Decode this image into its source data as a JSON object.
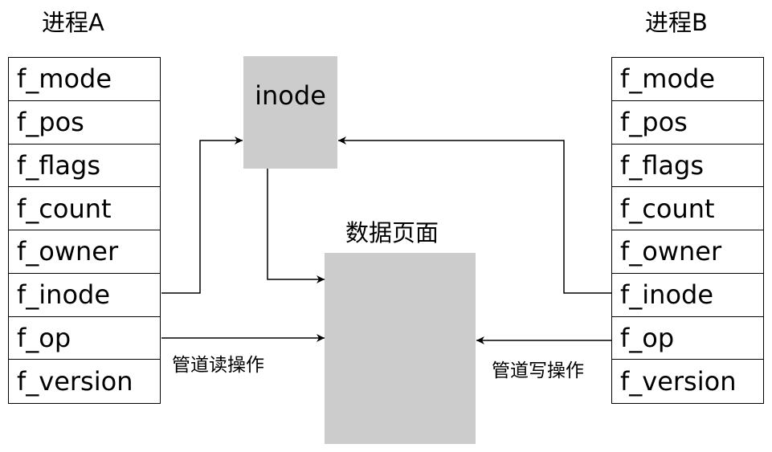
{
  "process_a": {
    "title": "进程A",
    "fields": [
      "f_mode",
      "f_pos",
      "f_flags",
      "f_count",
      "f_owner",
      "f_inode",
      "f_op",
      "f_version"
    ]
  },
  "process_b": {
    "title": "进程B",
    "fields": [
      "f_mode",
      "f_pos",
      "f_flags",
      "f_count",
      "f_owner",
      "f_inode",
      "f_op",
      "f_version"
    ]
  },
  "inode": {
    "label": "inode"
  },
  "data_page": {
    "label": "数据页面"
  },
  "edges": {
    "read_label": "管道读操作",
    "write_label": "管道写操作"
  },
  "colors": {
    "box_fill": "#cccccc",
    "line": "#000000"
  }
}
